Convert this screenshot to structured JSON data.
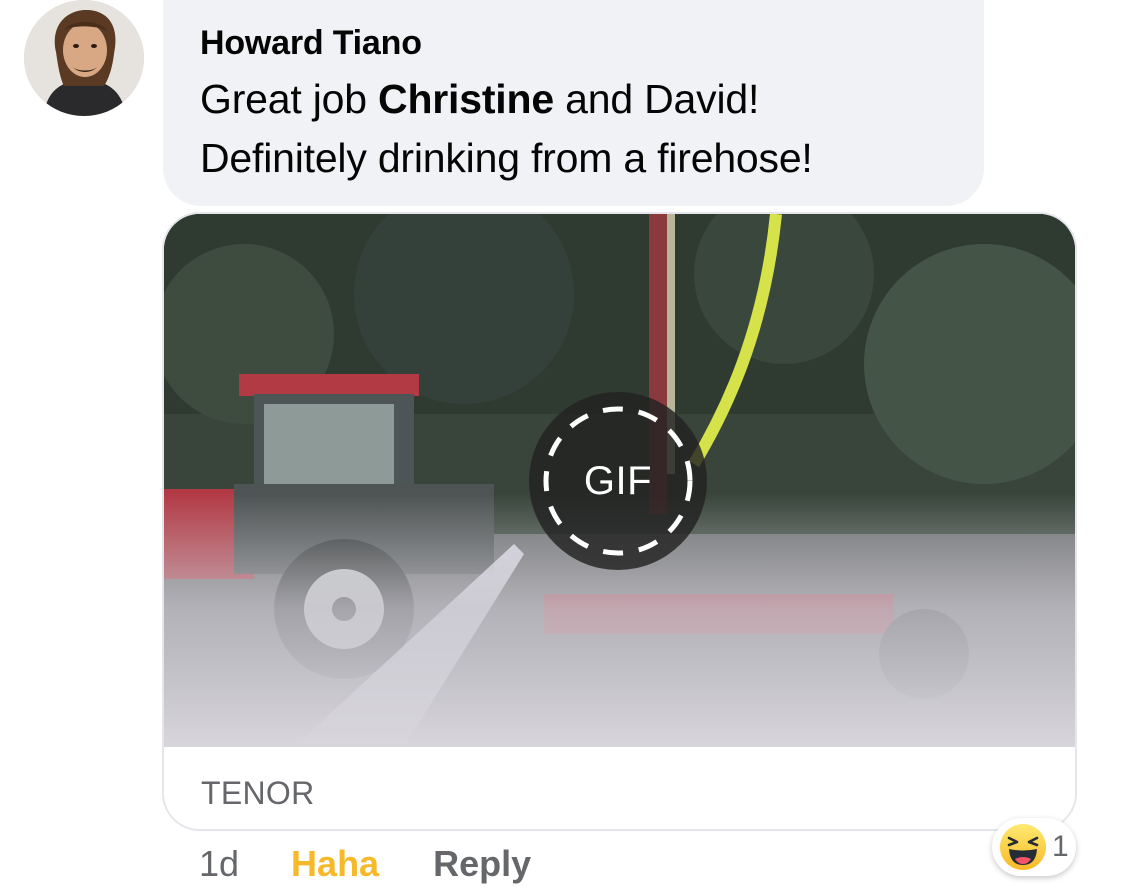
{
  "comment": {
    "author": "Howard Tiano",
    "text_part1": "Great job ",
    "mention": "Christine",
    "text_part2": " and David!",
    "text_line2": "Definitely drinking from a firehose!"
  },
  "gif": {
    "badge_label": "GIF",
    "source": "TENOR"
  },
  "actions": {
    "time": "1d",
    "reaction_label": "Haha",
    "reply_label": "Reply"
  },
  "reaction_summary": {
    "icon": "haha-emoji-icon",
    "count": "1"
  },
  "colors": {
    "bubble": "#f0f2f5",
    "text": "#050505",
    "secondary": "#65676b",
    "haha": "#f7b928"
  }
}
